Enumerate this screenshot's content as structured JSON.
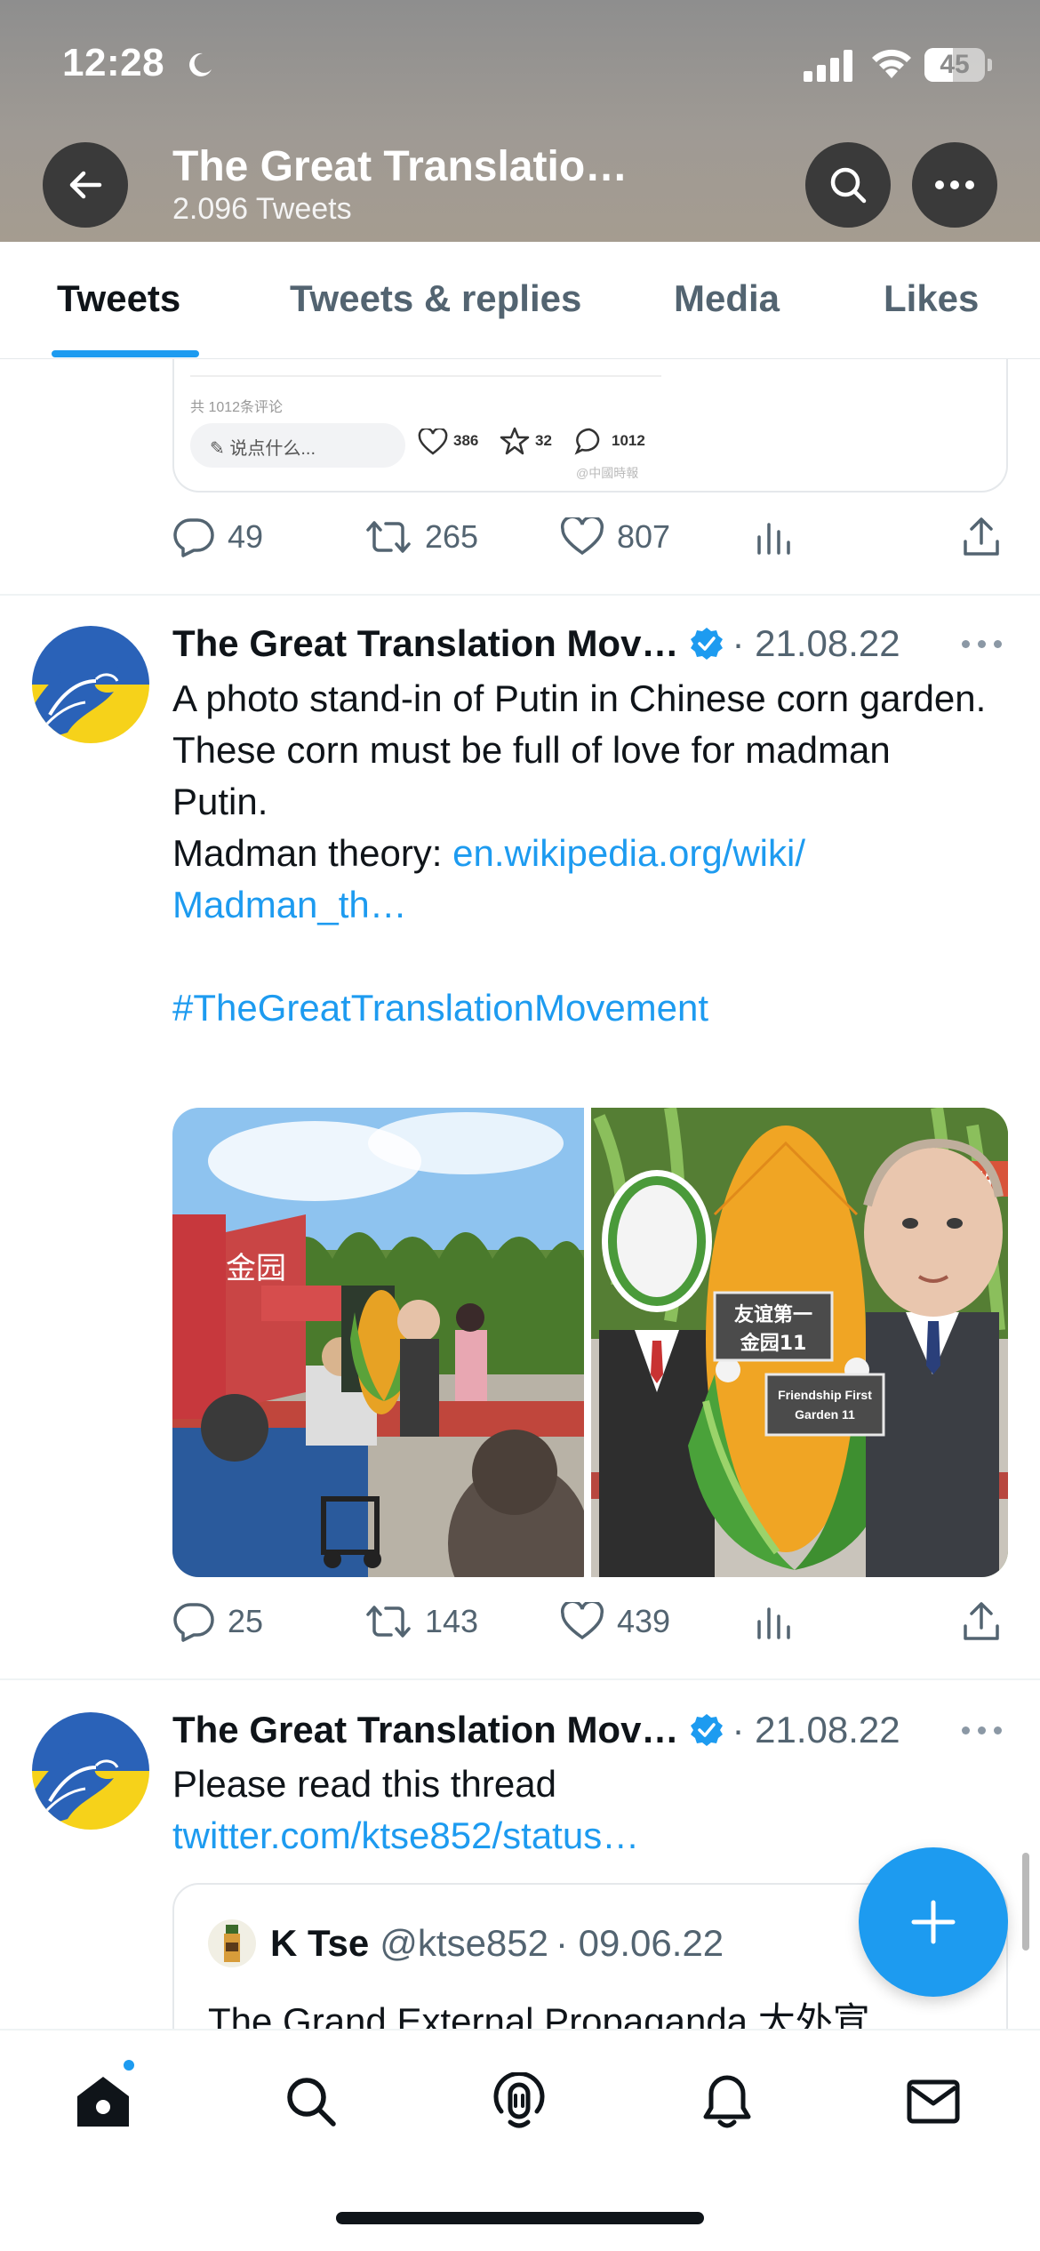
{
  "status_bar": {
    "time": "12:28",
    "battery": "45"
  },
  "header": {
    "title": "The Great Translatio…",
    "tweet_count": "2.096 Tweets"
  },
  "tabs": [
    {
      "label": "Tweets",
      "active": true
    },
    {
      "label": "Tweets & replies",
      "active": false
    },
    {
      "label": "Media",
      "active": false
    },
    {
      "label": "Likes",
      "active": false
    }
  ],
  "previous_tweet": {
    "quote_fragment": {
      "comment_count_text": "共 1012条评论",
      "input_placeholder": "说点什么...",
      "likes": "386",
      "stars": "32",
      "comments": "1012",
      "watermark": "@中國時報"
    },
    "actions": {
      "replies": "49",
      "retweets": "265",
      "likes": "807"
    }
  },
  "tweets": [
    {
      "author": "The Great Translation Mov…",
      "date": "· 21.08.22",
      "text_line1": "A photo stand-in of Putin in Chinese corn garden.",
      "text_line2": "These corn must be full of love for madman Putin.",
      "text_line3_prefix": "Madman theory: ",
      "link": "en.wikipedia.org/wiki/ Madman_th…",
      "hashtag": "#TheGreatTranslationMovement",
      "media": {
        "left_sign": "金园",
        "board_cn": "友谊第一 金园11",
        "board_en": "Friendship First Garden 11",
        "corner_cn": "株"
      },
      "actions": {
        "replies": "25",
        "retweets": "143",
        "likes": "439"
      }
    },
    {
      "author": "The Great Translation Mov…",
      "date": "· 21.08.22",
      "text": "Please read this thread",
      "link": "twitter.com/ktse852/status…",
      "quoted": {
        "name": "K Tse",
        "handle": "@ktse852",
        "date": "· 09.06.22",
        "text": "The Grand External Propaganda 大外宣"
      }
    }
  ],
  "colors": {
    "accent": "#1d9bf0",
    "text": "#0f1419",
    "secondary": "#536471"
  },
  "bottom_nav": [
    "home-icon",
    "search-icon",
    "spaces-icon",
    "notifications-icon",
    "messages-icon"
  ]
}
